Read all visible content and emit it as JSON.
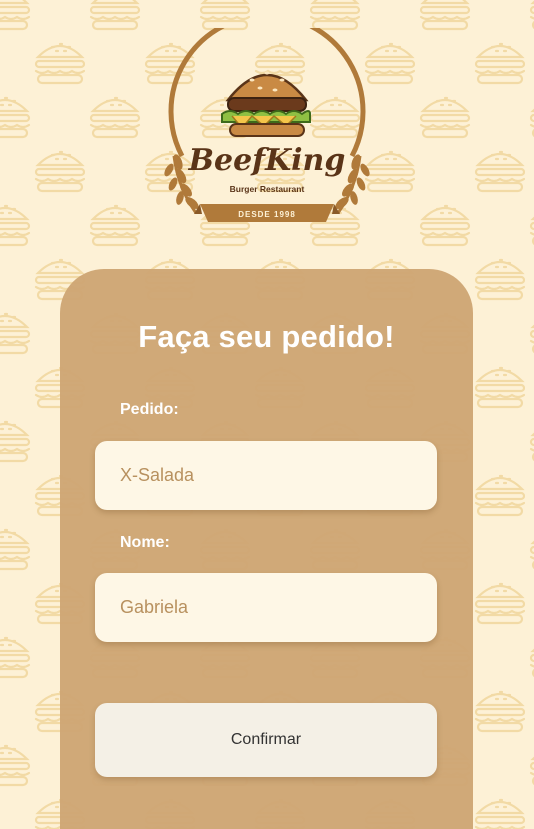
{
  "brand": {
    "name": "BeefKing",
    "tagline": "Burger Restaurant",
    "since": "DESDE 1998"
  },
  "form": {
    "title": "Faça seu pedido!",
    "pedido_label": "Pedido:",
    "pedido_placeholder": "X-Salada",
    "nome_label": "Nome:",
    "nome_placeholder": "Gabriela",
    "confirm_label": "Confirmar"
  },
  "colors": {
    "background": "#fdf1d6",
    "pattern": "#f3dca8",
    "card": "#cea674",
    "input": "#fef7e6",
    "logo_brown": "#b07a3a",
    "logo_dark": "#5a3418"
  },
  "icons": {
    "background_pattern": "burger-icon",
    "logo_left_wreath": "wheat-icon",
    "logo_right_wreath": "wheat-icon"
  }
}
